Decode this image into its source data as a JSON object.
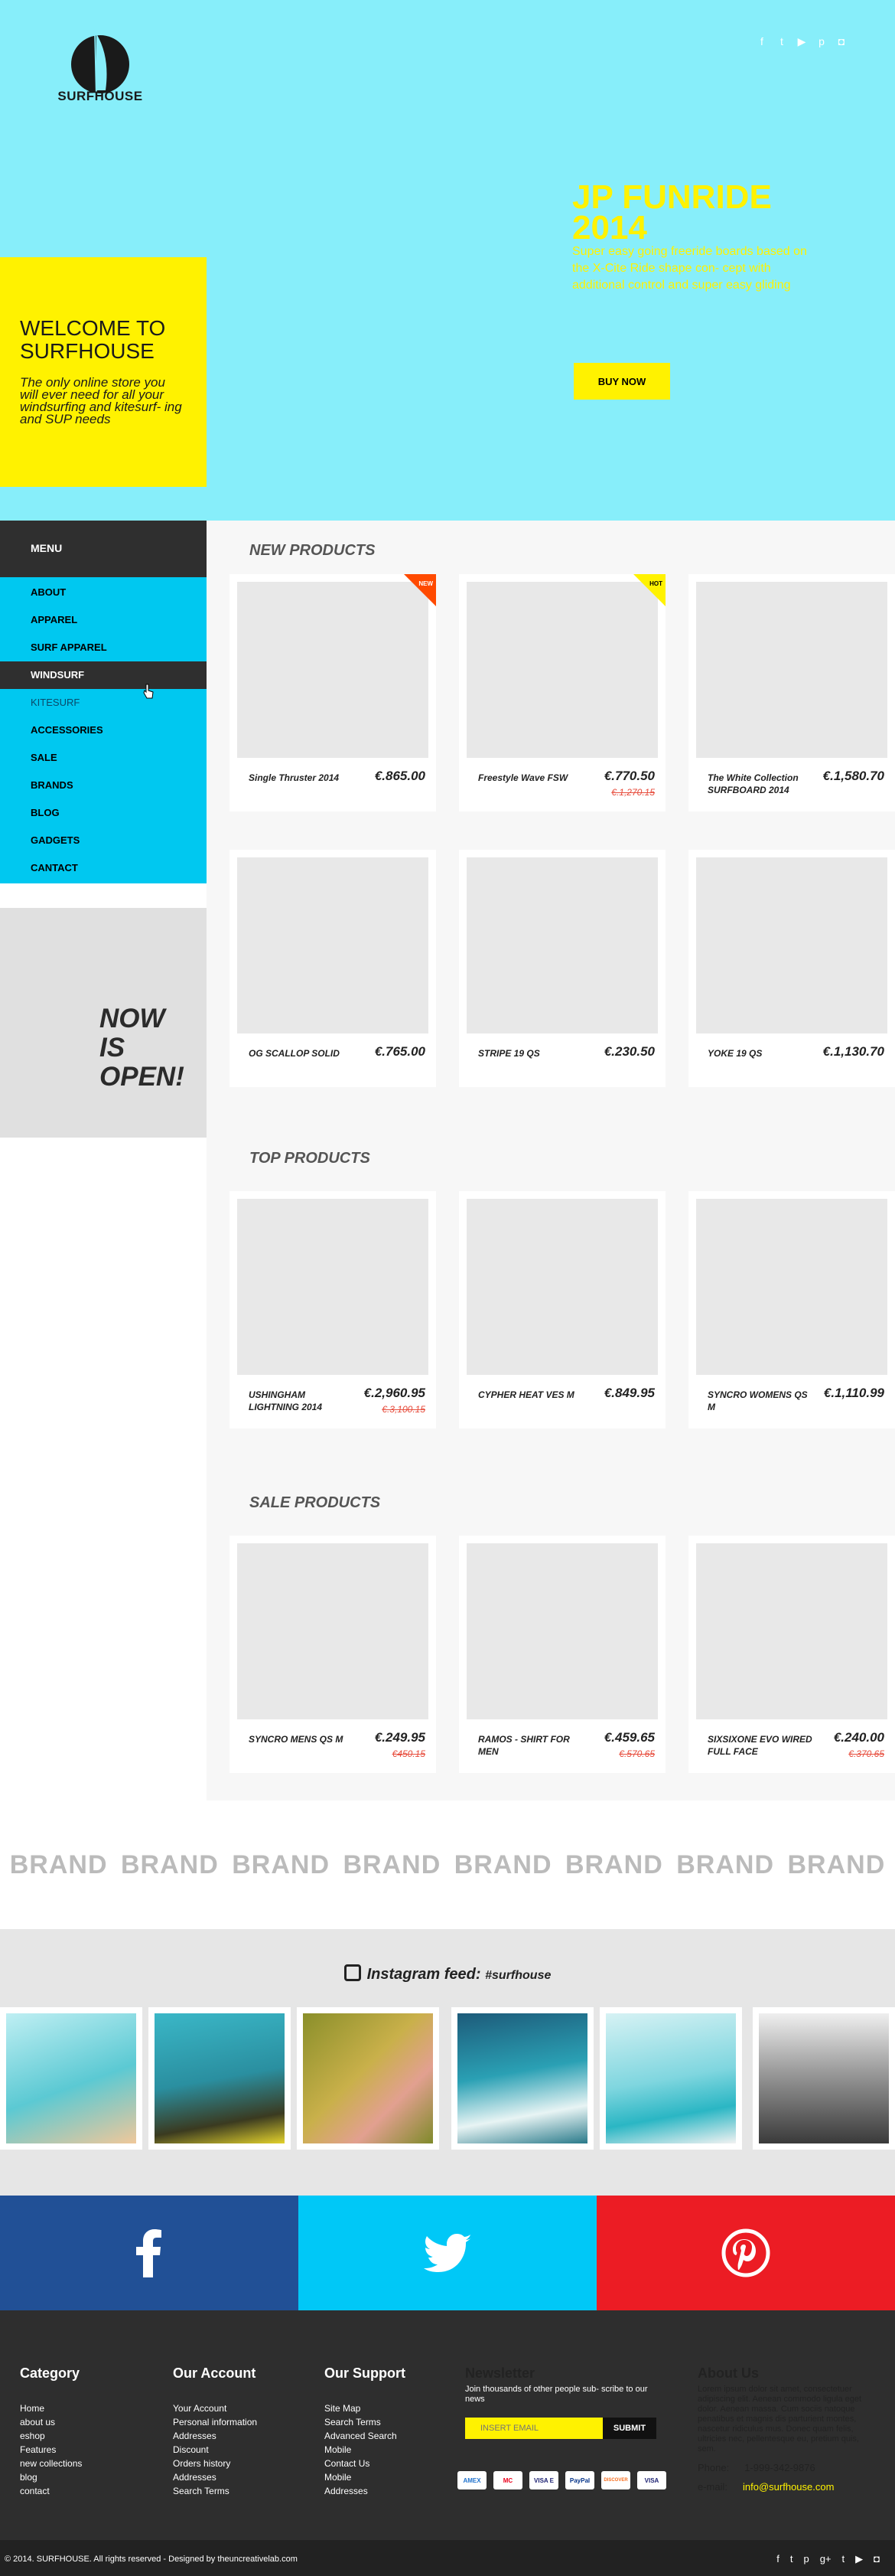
{
  "brand": {
    "name": "SURFHOUSE"
  },
  "social_top": [
    "facebook-icon",
    "twitter-icon",
    "youtube-icon",
    "pinterest-icon",
    "instagram-icon"
  ],
  "hero": {
    "promo_title": "JP FUNRIDE 2014",
    "promo_text": "Super easy going freeride boards based on the X-Cite Ride shape con- cept with additional control and super easy gliding",
    "buy_label": "BUY NOW",
    "welcome_title": "WELCOME TO SURFHOUSE",
    "welcome_text": "The only online store you will ever need for all your windsurfing and kitesurf- ing and SUP needs"
  },
  "menu": {
    "header": "MENU",
    "items": [
      "ABOUT",
      "APPAREL",
      "SURF APPAREL",
      "WINDSURF",
      "KITESURF",
      "ACCESSORIES",
      "SALE",
      "BRANDS",
      "BLOG",
      "GADGETS",
      "CANTACT"
    ]
  },
  "now_open": "NOW IS OPEN!",
  "new_products": {
    "title": "NEW PRODUCTS",
    "items": [
      {
        "name": "Single Thruster 2014",
        "price": "€.865.00",
        "badge": "NEW"
      },
      {
        "name": "Freestyle Wave FSW",
        "price": "€.770.50",
        "old": "€.1,270.15",
        "badge": "HOT"
      },
      {
        "name": "The White Collection SURFBOARD 2014",
        "price": "€.1,580.70"
      },
      {
        "name": "OG SCALLOP SOLID",
        "price": "€.765.00"
      },
      {
        "name": "STRIPE 19 QS",
        "price": "€.230.50"
      },
      {
        "name": "YOKE 19 QS",
        "price": "€.1,130.70"
      }
    ]
  },
  "top_products": {
    "title": "TOP PRODUCTS",
    "items": [
      {
        "name": "USHINGHAM LIGHTNING 2014",
        "price": "€.2,960.95",
        "old": "€.3,100.15"
      },
      {
        "name": "CYPHER HEAT VES M",
        "price": "€.849.95"
      },
      {
        "name": "SYNCRO WOMENS QS M",
        "price": "€.1,110.99"
      }
    ]
  },
  "sale_products": {
    "title": "SALE PRODUCTS",
    "items": [
      {
        "name": "SYNCRO MENS QS M",
        "price": "€.249.95",
        "old": "€450.15"
      },
      {
        "name": "RAMOS - SHIRT FOR MEN",
        "price": "€.459.65",
        "old": "€.570.65"
      },
      {
        "name": "SIXSIXONE EVO WIRED FULL FACE",
        "price": "€.240.00",
        "old": "€.370.65"
      }
    ]
  },
  "brands": [
    "BRAND",
    "BRAND",
    "BRAND",
    "BRAND",
    "BRAND",
    "BRAND",
    "BRAND",
    "BRAND"
  ],
  "instagram": {
    "label": "Instagram feed:",
    "tag": "#surfhouse"
  },
  "share": [
    "facebook-icon",
    "twitter-icon",
    "pinterest-icon"
  ],
  "colors": {
    "cyan": "#87eefa",
    "yellow": "#fff200",
    "menu_blue": "#00c8f0",
    "dark": "#2f2f2f",
    "facebook": "#215096",
    "twitter": "#00c8f7",
    "pinterest": "#ec1c24"
  },
  "footer": {
    "category": {
      "title": "Category",
      "items": [
        "Home",
        "about us",
        "eshop",
        "Features",
        "new collections",
        "blog",
        "contact"
      ]
    },
    "account": {
      "title": "Our Account",
      "items": [
        "Your Account",
        "Personal information",
        "Addresses",
        "Discount",
        "Orders history",
        "Addresses",
        "Search Terms"
      ]
    },
    "support": {
      "title": "Our Support",
      "items": [
        "Site Map",
        "Search Terms",
        "Advanced Search",
        "Mobile",
        "Contact Us",
        "Mobile",
        "Addresses"
      ]
    },
    "newsletter": {
      "title": "Newsletter",
      "text": "Join thousands of other people sub- scribe to our news",
      "placeholder": "INSERT EMAIL",
      "submit": "SUBMIT"
    },
    "payment": [
      "AMEX",
      "MC",
      "VISA E",
      "PayPal",
      "DISCOVER",
      "VISA"
    ],
    "about": {
      "title": "About Us",
      "text": "Lorem ipsum dolor sit amet, consectetuer adipiscing elit. Aenean commodo ligula eget dolor. Aenean massa. Cum sociis natoque penatibus et magnis dis parturient montes, nascetur ridiculus mus. Donec quam felis, ultricies nec, pellentesque eu, pretium quis, sem.",
      "phone_label": "Phone:",
      "phone": "1-999-342-9876",
      "email_label": "e-mail:",
      "email": "info@surfhouse.com"
    },
    "copyright": "© 2014. SURFHOUSE. All rights reserved - Designed by theuncreativelab.com",
    "social": [
      "facebook-icon",
      "twitter-icon",
      "pinterest-icon",
      "googleplus-icon",
      "tumblr-icon",
      "youtube-icon",
      "instagram-icon"
    ]
  }
}
